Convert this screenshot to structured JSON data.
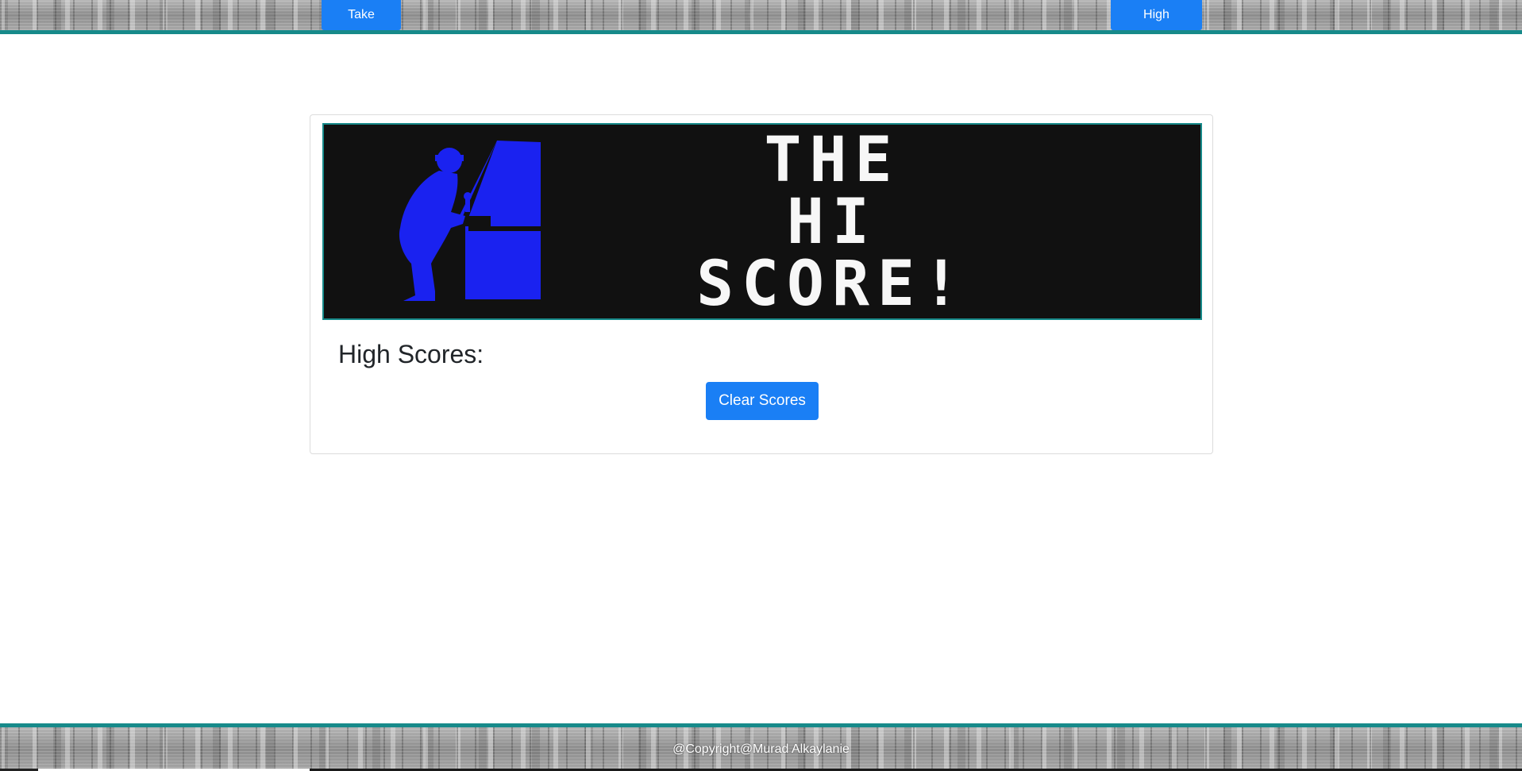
{
  "nav": {
    "take_quiz_label": "Take Quiz",
    "high_scores_label": "High Scores"
  },
  "banner": {
    "line1": "THE",
    "line2": "HI",
    "line3": "SCORE!",
    "figure_color": "#1a22f0",
    "background_color": "#111111"
  },
  "main": {
    "heading": "High Scores:",
    "clear_button_label": "Clear Scores"
  },
  "footer": {
    "copyright_text": "@Copyright@Murad Alkaylanie"
  },
  "colors": {
    "accent": "#1a7ff5",
    "border_teal": "#178a8a"
  }
}
